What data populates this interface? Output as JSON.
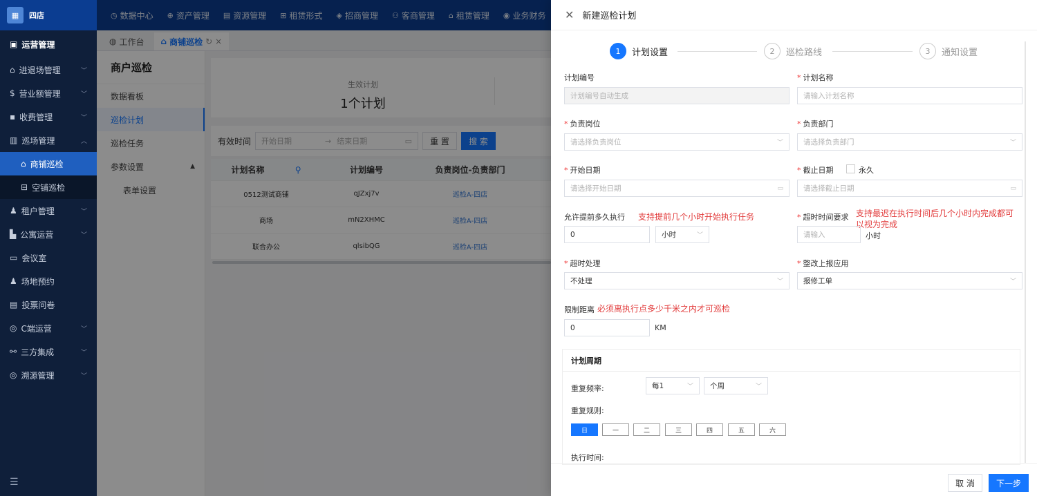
{
  "app": {
    "logo_text": "四店"
  },
  "topnav": [
    {
      "icon": "◷",
      "label": "数据中心"
    },
    {
      "icon": "⊕",
      "label": "资产管理"
    },
    {
      "icon": "▤",
      "label": "资源管理"
    },
    {
      "icon": "⊞",
      "label": "租赁形式"
    },
    {
      "icon": "◈",
      "label": "招商管理"
    },
    {
      "icon": "⚇",
      "label": "客商管理"
    },
    {
      "icon": "⌂",
      "label": "租赁管理"
    },
    {
      "icon": "◉",
      "label": "业务财务"
    }
  ],
  "sidebar": {
    "header": "运营管理",
    "items": [
      {
        "label": "进退场管理",
        "icon": "⌂"
      },
      {
        "label": "营业额管理",
        "icon": "$"
      },
      {
        "label": "收费管理",
        "icon": "▪"
      },
      {
        "label": "巡场管理",
        "icon": "▥"
      },
      {
        "label": "商铺巡检",
        "icon": "⌂"
      },
      {
        "label": "空铺巡检",
        "icon": "⊟"
      },
      {
        "label": "租户管理",
        "icon": "♟"
      },
      {
        "label": "公寓运营",
        "icon": "▙"
      },
      {
        "label": "会议室",
        "icon": "▭"
      },
      {
        "label": "场地预约",
        "icon": "♟"
      },
      {
        "label": "投票问卷",
        "icon": "▤"
      },
      {
        "label": "C端运营",
        "icon": "◎"
      },
      {
        "label": "三方集成",
        "icon": "⚯"
      },
      {
        "label": "溯源管理",
        "icon": "◎"
      }
    ],
    "bottom_icon": "☰"
  },
  "tabs": [
    {
      "label": "工作台",
      "icon": "◍"
    },
    {
      "label": "商铺巡检",
      "icon": "⌂",
      "refresh": "↻",
      "close": "×"
    }
  ],
  "inner_menu": {
    "title": "商户巡检",
    "items": [
      "数据看板",
      "巡检计划",
      "巡检任务",
      "参数设置",
      "表单设置"
    ]
  },
  "main": {
    "stat_label": "生效计划",
    "stat_value": "1个计划",
    "filter": {
      "label": "有效时间",
      "start_placeholder": "开始日期",
      "arrow": "→",
      "end_placeholder": "结束日期",
      "reset": "重 置",
      "search": "搜 索"
    },
    "table": {
      "headers": [
        "计划名称",
        "计划编号",
        "负责岗位-负责部门"
      ],
      "rows": [
        [
          "0512测试商铺",
          "qJZxj7v",
          "巡检A-四店"
        ],
        [
          "商场",
          "mN2XHMC",
          "巡检A-四店"
        ],
        [
          "联合办公",
          "qlsibQG",
          "巡检A-四店"
        ]
      ]
    }
  },
  "drawer": {
    "title": "新建巡检计划",
    "steps": [
      {
        "num": "1",
        "label": "计划设置"
      },
      {
        "num": "2",
        "label": "巡检路线"
      },
      {
        "num": "3",
        "label": "通知设置"
      }
    ],
    "fields": {
      "plan_no_label": "计划编号",
      "plan_no_placeholder": "计划编号自动生成",
      "plan_name_label": "计划名称",
      "plan_name_placeholder": "请输入计划名称",
      "post_label": "负责岗位",
      "post_placeholder": "请选择负责岗位",
      "dept_label": "负责部门",
      "dept_placeholder": "请选择负责部门",
      "start_label": "开始日期",
      "start_placeholder": "请选择开始日期",
      "end_label": "截止日期",
      "forever_label": "永久",
      "end_placeholder": "请选择截止日期",
      "advance_label": "允许提前多久执行",
      "advance_note": "支持提前几个小时开始执行任务",
      "advance_value": "0",
      "advance_unit": "小时",
      "timeout_req_label": "超时时间要求",
      "timeout_req_note_1": "支持最迟在执行时间后几个小时内完成都可",
      "timeout_req_note_2": "以视为完成",
      "timeout_req_placeholder": "请输入",
      "timeout_req_unit": "小时",
      "timeout_handle_label": "超时处理",
      "timeout_handle_value": "不处理",
      "rectify_label": "整改上报应用",
      "rectify_value": "报修工单",
      "distance_label": "限制距离",
      "distance_note": "必须离执行点多少千米之内才可巡检",
      "distance_value": "0",
      "distance_unit": "KM"
    },
    "period": {
      "title": "计划周期",
      "repeat_freq_label": "重复频率:",
      "freq_value": "每1",
      "freq_unit": "个周",
      "repeat_rule_label": "重复规则:",
      "days": [
        "日",
        "一",
        "二",
        "三",
        "四",
        "五",
        "六"
      ],
      "exec_time_label": "执行时间:"
    },
    "footer": {
      "cancel": "取 消",
      "next": "下一步"
    }
  }
}
